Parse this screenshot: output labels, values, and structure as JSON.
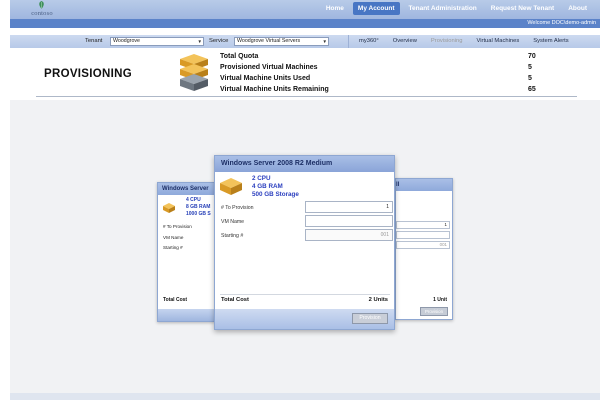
{
  "brand": {
    "name": "contoso"
  },
  "top_nav": {
    "items": [
      {
        "label": "Home",
        "active": false
      },
      {
        "label": "My Account",
        "active": true
      },
      {
        "label": "Tenant Administration",
        "active": false
      },
      {
        "label": "Request New Tenant",
        "active": false
      },
      {
        "label": "About",
        "active": false
      }
    ]
  },
  "welcome": "Welcome DOC\\demo-admin",
  "filters": {
    "tenant_label": "Tenant",
    "tenant_value": "Woodgrove",
    "service_label": "Service",
    "service_value": "Woodgrove Virtual Servers"
  },
  "sub_nav": {
    "items": [
      {
        "label": "my360°",
        "current": false
      },
      {
        "label": "Overview",
        "current": false
      },
      {
        "label": "Provisioning",
        "current": true
      },
      {
        "label": "Virtual Machines",
        "current": false
      },
      {
        "label": "System Alerts",
        "current": false
      }
    ]
  },
  "page_title": "PROVISIONING",
  "quota": [
    {
      "label": "Total Quota",
      "value": "70"
    },
    {
      "label": "Provisioned Virtual Machines",
      "value": "5"
    },
    {
      "label": "Virtual Machine Units Used",
      "value": "5"
    },
    {
      "label": "Virtual Machine Units Remaining",
      "value": "65"
    }
  ],
  "main_card": {
    "title": "Windows Server 2008 R2 Medium",
    "specs": [
      "2 CPU",
      "4 GB RAM",
      "500 GB Storage"
    ],
    "to_provision_label": "# To Provision",
    "to_provision_value": "1",
    "vm_name_label": "VM Name",
    "vm_name_value": "",
    "starting_label": "Starting #",
    "starting_value": "001",
    "total_cost_label": "Total Cost",
    "total_units": "2 Units",
    "provision_button": "Provision"
  },
  "left_card": {
    "title": "Windows Server",
    "specs": [
      "4 CPU",
      "8 GB RAM",
      "1000 GB S"
    ],
    "to_provision_label": "# To Provision",
    "vm_name_label": "VM Name",
    "starting_label": "Starting #",
    "total_cost_label": "Total Cost"
  },
  "right_card": {
    "title": "ll",
    "to_provision_value": "1",
    "starting_value": "001",
    "total_units": "1 Unit",
    "provision_button": "Provision"
  },
  "colors": {
    "nav_bar": "#9fb6df",
    "active_tab": "#4876c4",
    "spec_text": "#2b3fbf",
    "card_header": "#a9bfe6"
  }
}
